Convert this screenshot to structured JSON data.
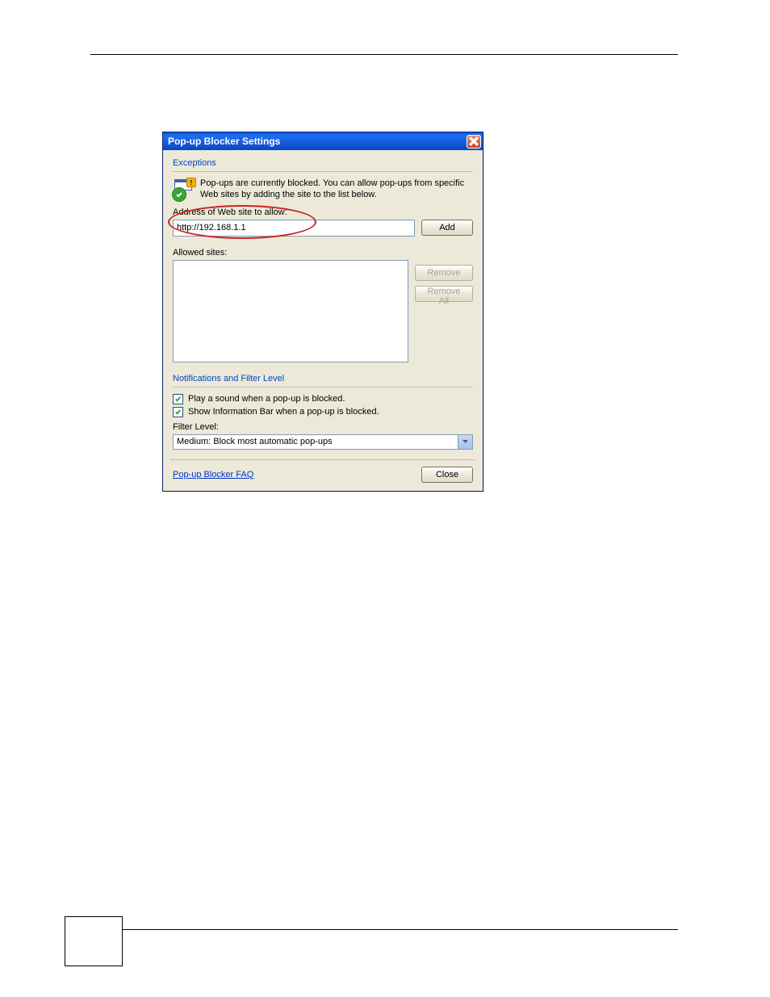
{
  "dialog": {
    "title": "Pop-up Blocker Settings",
    "exceptions": {
      "header": "Exceptions",
      "intro": "Pop-ups are currently blocked. You can allow pop-ups from specific Web sites by adding the site to the list below.",
      "address_label": "Address of Web site to allow:",
      "address_value": "http://192.168.1.1",
      "add_button": "Add",
      "allowed_label": "Allowed sites:",
      "remove_button": "Remove",
      "remove_all_button": "Remove All"
    },
    "notifications": {
      "header": "Notifications and Filter Level",
      "play_sound_label": "Play a sound when a pop-up is blocked.",
      "play_sound_checked": true,
      "show_info_bar_label": "Show Information Bar when a pop-up is blocked.",
      "show_info_bar_checked": true,
      "filter_level_label": "Filter Level:",
      "filter_level_value": "Medium: Block most automatic pop-ups"
    },
    "footer": {
      "faq_link": "Pop-up Blocker FAQ",
      "close_button": "Close"
    }
  }
}
